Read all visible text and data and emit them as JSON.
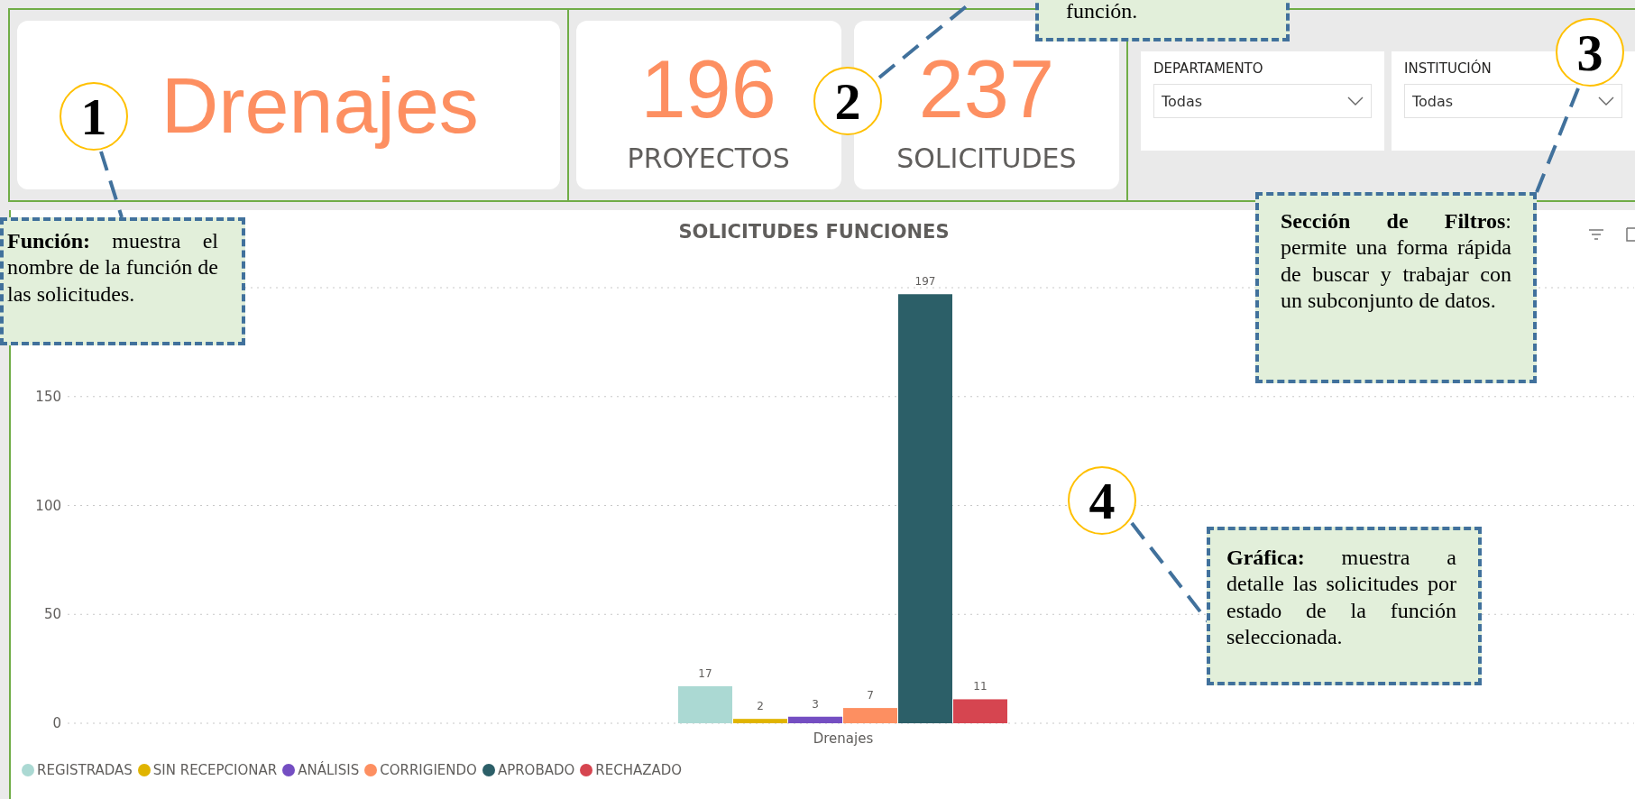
{
  "summary_cards": [
    {
      "kind": "title",
      "value": "Drenajes"
    },
    {
      "kind": "metric",
      "value": "196",
      "label": "PROYECTOS"
    },
    {
      "kind": "metric",
      "value": "237",
      "label": "SOLICITUDES"
    }
  ],
  "filters": [
    {
      "label": "DEPARTAMENTO",
      "value": "Todas"
    },
    {
      "label": "INSTITUCIÓN",
      "value": "Todas"
    }
  ],
  "chart": {
    "title": "SOLICITUDES FUNCIONES",
    "chart_data": {
      "type": "bar",
      "categories": [
        "Drenajes"
      ],
      "grid": true,
      "ylim": [
        0,
        200
      ],
      "yticks": [
        0,
        50,
        100,
        150
      ],
      "data_labels": true,
      "series": [
        {
          "name": "REGISTRADAS",
          "color": "#abd9d3",
          "values": [
            17
          ]
        },
        {
          "name": "SIN RECEPCIONAR",
          "color": "#e0b400",
          "values": [
            2
          ]
        },
        {
          "name": "ANÁLISIS",
          "color": "#744ec2",
          "values": [
            3
          ]
        },
        {
          "name": "CORRIGIENDO",
          "color": "#fd8f61",
          "values": [
            7
          ]
        },
        {
          "name": "APROBADO",
          "color": "#2c5f68",
          "values": [
            197
          ]
        },
        {
          "name": "RECHAZADO",
          "color": "#d64550",
          "values": [
            11
          ]
        }
      ]
    }
  },
  "annotations": [
    {
      "number": "1",
      "text": "**Función:** muestra el nombre de la función de las solicitudes."
    },
    {
      "number": "2",
      "text": "función."
    },
    {
      "number": "3",
      "text": "**Sección de Filtros**: permite una forma rápida de buscar y trabajar con un subconjunto de datos."
    },
    {
      "number": "4",
      "text": "**Gráfica:** muestra a detalle las solicitudes por estado de la función seleccionada."
    }
  ]
}
